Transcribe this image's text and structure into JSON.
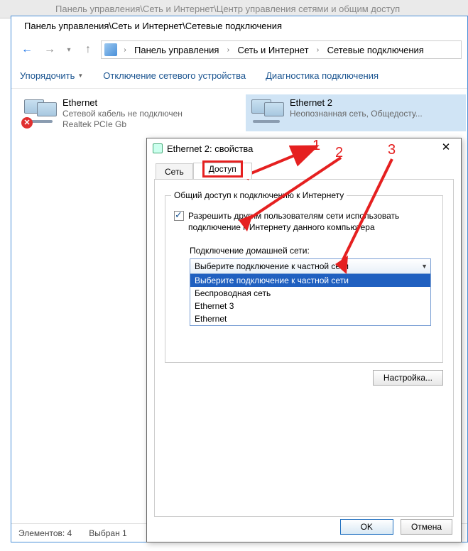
{
  "bg_window_title": "Панель управления\\Сеть и Интернет\\Центр управления сетями и общим доступ",
  "window_title": "Панель управления\\Сеть и Интернет\\Сетевые подключения",
  "breadcrumbs": {
    "part1": "Панель управления",
    "part2": "Сеть и Интернет",
    "part3": "Сетевые подключения"
  },
  "toolbar": {
    "organize": "Упорядочить",
    "disable": "Отключение сетевого устройства",
    "diagnose": "Диагностика подключения"
  },
  "connections": [
    {
      "name": "Ethernet",
      "status": "Сетевой кабель не подключен",
      "adapter": "Realtek PCIe Gb",
      "has_error": true
    },
    {
      "name": "Ethernet 2",
      "status": "Неопознанная сеть, Общедосту...",
      "adapter": "",
      "has_error": false
    }
  ],
  "statusbar": {
    "elements": "Элементов: 4",
    "selected": "Выбран 1"
  },
  "dialog": {
    "title": "Ethernet 2: свойства",
    "tabs": {
      "network": "Сеть",
      "sharing": "Доступ"
    },
    "group_label": "Общий доступ к подключению к Интернету",
    "allow_share_label": "Разрешить другим пользователям сети использовать подключение к Интернету данного компьютера",
    "home_net_label": "Подключение домашней сети:",
    "combo_selected": "Выберите подключение к частной сети",
    "combo_options": [
      "Выберите подключение к частной сети",
      "Беспроводная сеть",
      "Ethernet 3",
      "Ethernet"
    ],
    "allow_control_label": "",
    "settings_btn": "Настройка...",
    "ok": "OK",
    "cancel": "Отмена"
  },
  "annotations": {
    "n1": "1",
    "n2": "2",
    "n3": "3"
  }
}
